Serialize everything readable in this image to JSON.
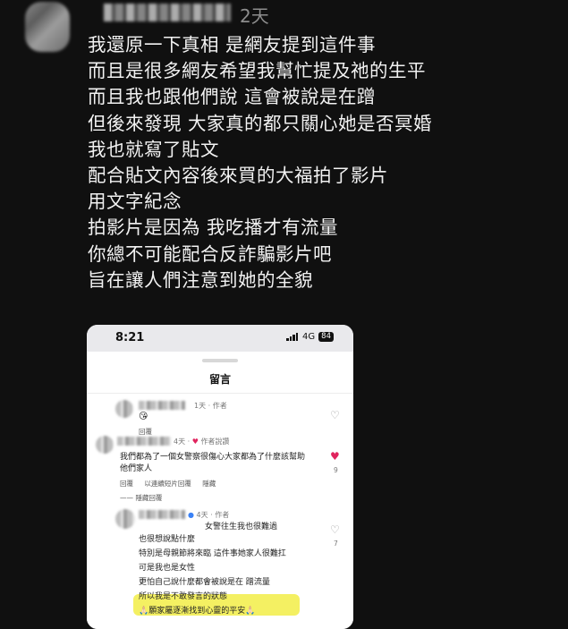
{
  "post": {
    "timestamp": "2天",
    "lines": [
      "我還原一下真相 是網友提到這件事",
      "而且是很多網友希望我幫忙提及祂的生平",
      "而且我也跟他們說 這會被說是在蹭",
      "但後來發現 大家真的都只關心她是否冥婚",
      "我也就寫了貼文",
      "配合貼文內容後來買的大福拍了影片",
      "用文字紀念",
      "拍影片是因為 我吃播才有流量",
      "你總不可能配合反詐騙影片吧",
      "旨在讓人們注意到她的全貌"
    ]
  },
  "screenshot": {
    "status_time": "8:21",
    "network": "4G",
    "battery": "84",
    "sheet_title": "留言",
    "c1": {
      "meta": "1天 · 作者",
      "emoji": "😘",
      "reply": "回覆"
    },
    "c2": {
      "meta": "4天 · ",
      "author_liked": "作者說讚",
      "text1": "我們都為了一個女警察很傷心大家都為了什麼該幫助",
      "text2": "他們家人",
      "reply": "回覆",
      "see_reply": "以連續短片回覆",
      "hide": "隱藏",
      "like_count": "9",
      "hidden_replies": "隱藏回覆"
    },
    "c3": {
      "meta": "4天 · 作者",
      "l1": "女警往生我也很難過",
      "l2": "也很想說點什麼",
      "l3": "特別是母親節將來臨 這件事她家人很難扛",
      "l4": "可是我也是女性",
      "l5": "更怕自己說什麼都會被說是在 蹭流量",
      "l6": "所以我是不敢發言的狀態",
      "l7": "🙏🏻願家屬逐漸找到心靈的平安🙏🏻",
      "like_count": "7"
    }
  }
}
